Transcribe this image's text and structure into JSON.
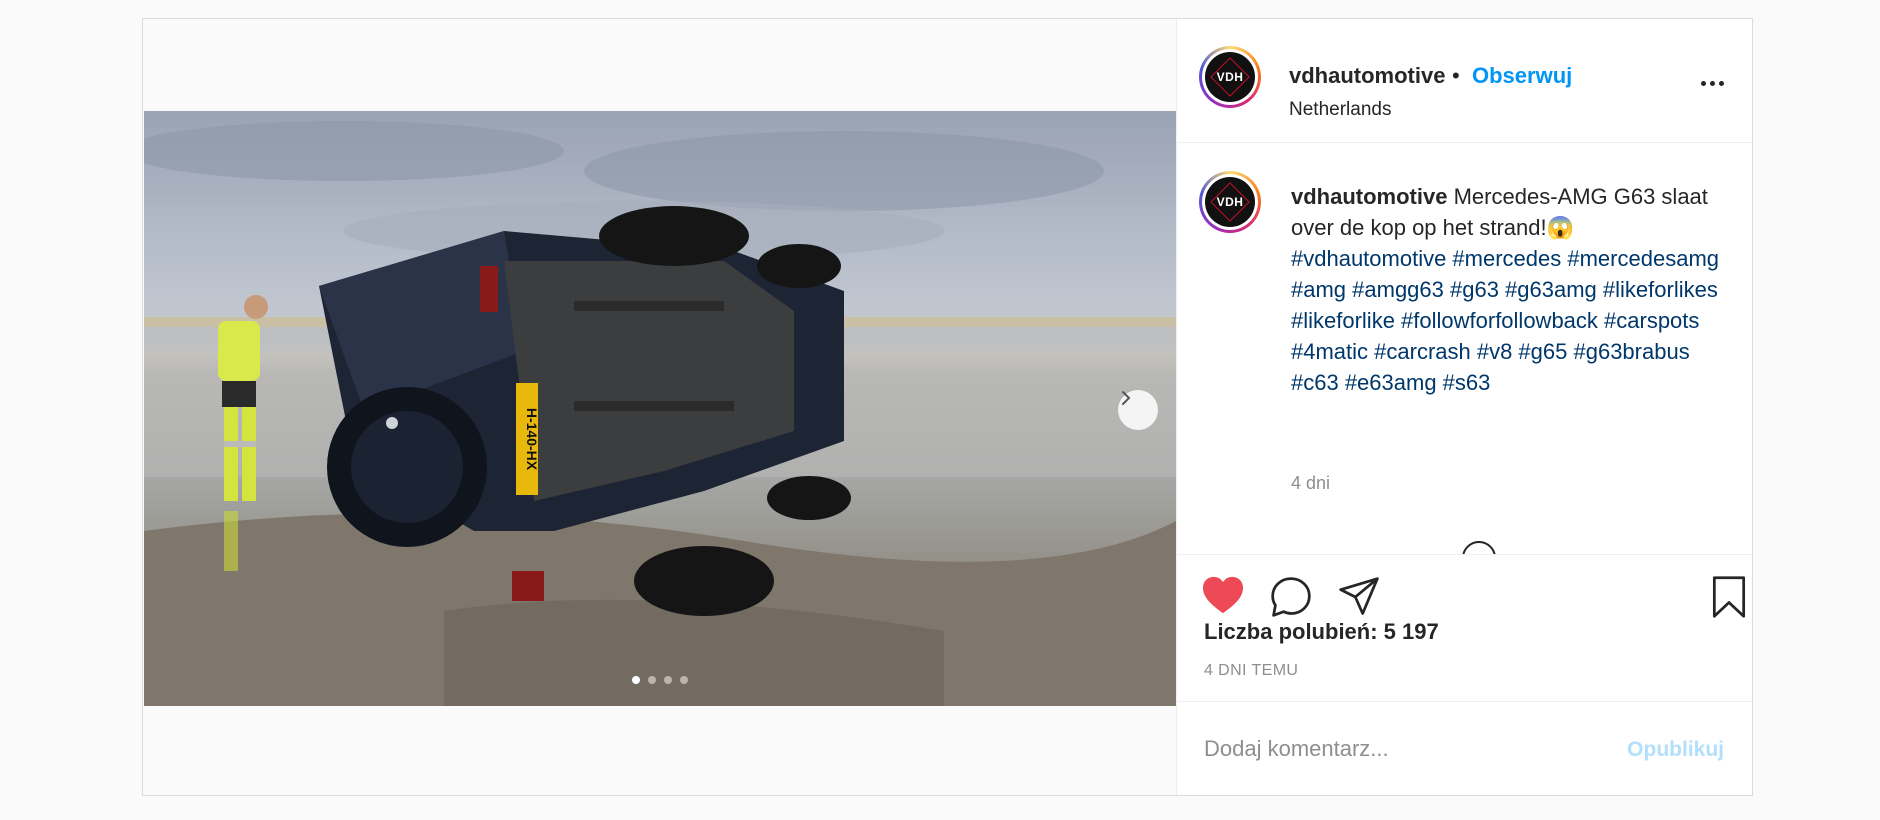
{
  "post": {
    "username": "vdhautomotive",
    "follow_separator": "•",
    "follow_label": "Obserwuj",
    "location": "Netherlands",
    "avatar_text": "VDH",
    "caption_text": "Mercedes-AMG G63 slaat over de kop op het strand!😱",
    "hashtags": "#vdhautomotive #mercedes #mercedesamg #amg #amgg63 #g63 #g63amg #likeforlikes #likeforlike #followforfollowback #carspots #4matic #carcrash #v8 #g65 #g63brabus #c63 #e63amg #s63",
    "caption_time": "4 dni",
    "likes": "Liczba polubień: 5 197",
    "time_ago": "4 DNI TEMU",
    "liked": true
  },
  "media": {
    "plate_text": "H-140-HX",
    "carousel_total": 4,
    "carousel_active": 1
  },
  "comment": {
    "placeholder": "Dodaj komentarz...",
    "publish_label": "Opublikuj"
  },
  "colors": {
    "accent": "#0095f6",
    "like": "#ed4956",
    "hashtag": "#00376b",
    "publish_disabled": "#b2dffc"
  },
  "icons": [
    "heart-icon",
    "comment-icon",
    "share-icon",
    "bookmark-icon",
    "chevron-right-icon",
    "more-icon"
  ]
}
